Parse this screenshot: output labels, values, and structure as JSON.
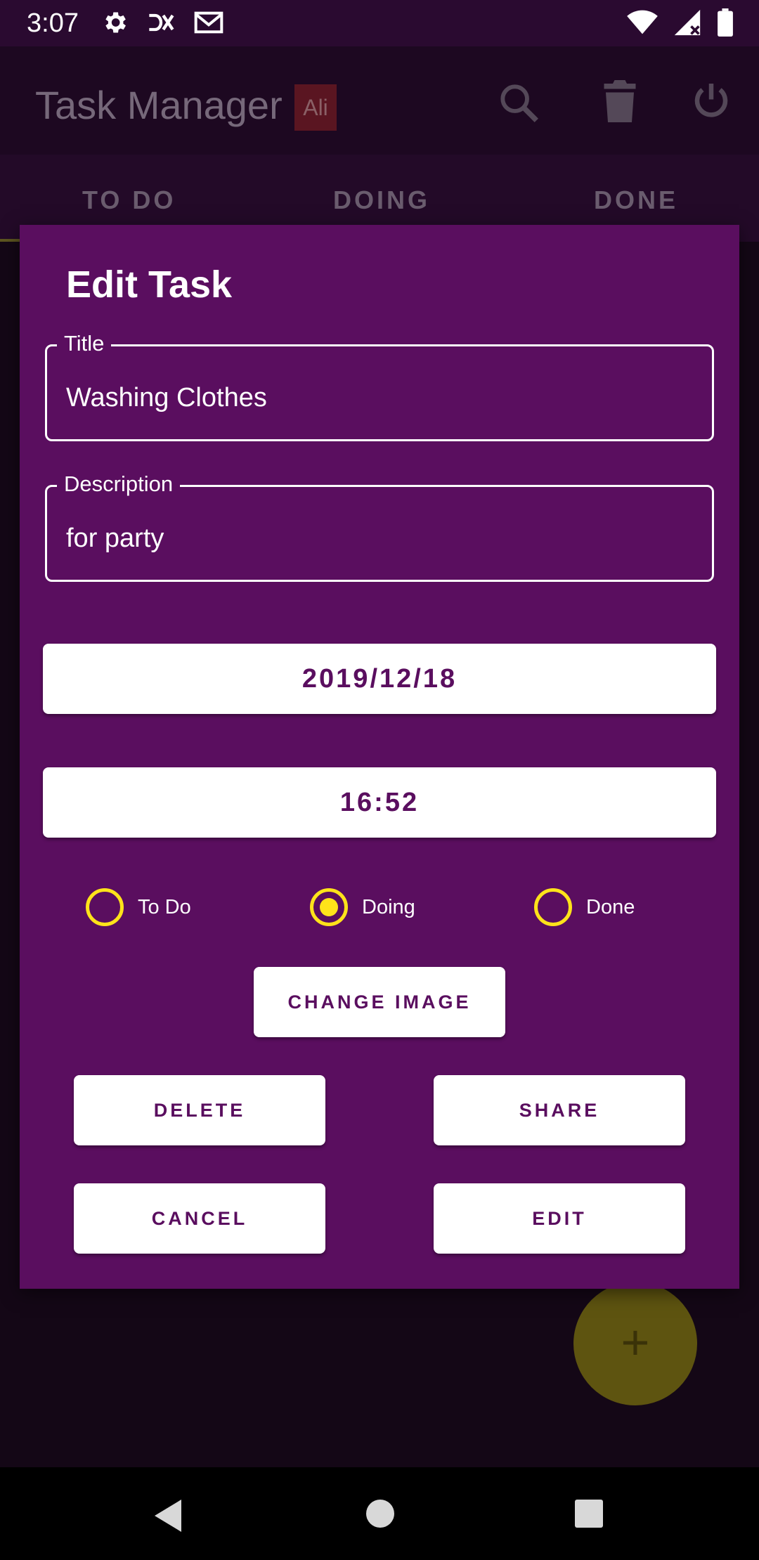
{
  "status_bar": {
    "time": "3:07",
    "left_icons": [
      "gear-icon",
      "dx-icon",
      "gmail-icon"
    ],
    "right_icons": [
      "wifi-icon",
      "signal-icon",
      "battery-icon"
    ]
  },
  "app_bar": {
    "title": "Task Manager",
    "user_badge": "Ali",
    "actions": [
      "search-icon",
      "trash-icon",
      "power-icon"
    ]
  },
  "tabs": [
    {
      "label": "TO DO",
      "selected": true
    },
    {
      "label": "DOING",
      "selected": false
    },
    {
      "label": "DONE",
      "selected": false
    }
  ],
  "dialog": {
    "title": "Edit Task",
    "title_field": {
      "label": "Title",
      "value": "Washing Clothes"
    },
    "description_field": {
      "label": "Description",
      "value": "for party"
    },
    "date": "2019/12/18",
    "time": "16:52",
    "status_options": [
      {
        "label": "To Do",
        "checked": false
      },
      {
        "label": "Doing",
        "checked": true
      },
      {
        "label": "Done",
        "checked": false
      }
    ],
    "buttons": {
      "change_image": "CHANGE IMAGE",
      "delete": "DELETE",
      "share": "SHARE",
      "cancel": "CANCEL",
      "edit": "EDIT"
    }
  },
  "fab": {
    "label": "+"
  },
  "colors": {
    "dialog_bg": "#5a0e5f",
    "accent": "#ffe31a",
    "button_text": "#5a0e5f"
  }
}
